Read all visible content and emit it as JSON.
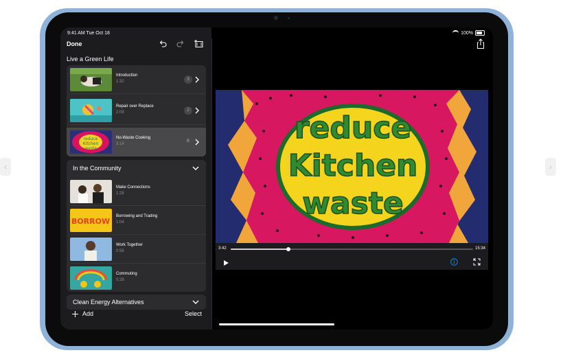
{
  "status": {
    "time": "9:41 AM  Tue Oct 18",
    "battery": "100%"
  },
  "toolbar": {
    "done_label": "Done"
  },
  "project_title": "Live a Green Life",
  "sections": {
    "first": {
      "items": [
        {
          "title": "Introduction",
          "duration": "1:32",
          "count": "3"
        },
        {
          "title": "Repair over Replace",
          "duration": "2:09",
          "count": "2"
        },
        {
          "title": "No-Waste Cooking",
          "duration": "3:14",
          "count": "6"
        }
      ]
    },
    "community": {
      "title": "In the Community",
      "items": [
        {
          "title": "Make Connections",
          "duration": "1:28"
        },
        {
          "title": "Borrowing and Trading",
          "duration": "1:04"
        },
        {
          "title": "Work Together",
          "duration": "0:56"
        },
        {
          "title": "Commuting",
          "duration": "0:28"
        }
      ]
    },
    "clean_energy": {
      "title": "Clean Energy Alternatives"
    }
  },
  "bottom": {
    "add_label": "Add",
    "select_label": "Select"
  },
  "player": {
    "title_art": [
      "reduce",
      "Kitchen",
      "waste"
    ],
    "current_time": "3:42",
    "total_time": "15:34",
    "progress": 0.237
  },
  "colors": {
    "accent": "#0a84ff",
    "ipad_frame": "#8fb2d8",
    "video_bg": "#232c6e"
  },
  "thumb_words": {
    "borrow": "BORROW"
  }
}
